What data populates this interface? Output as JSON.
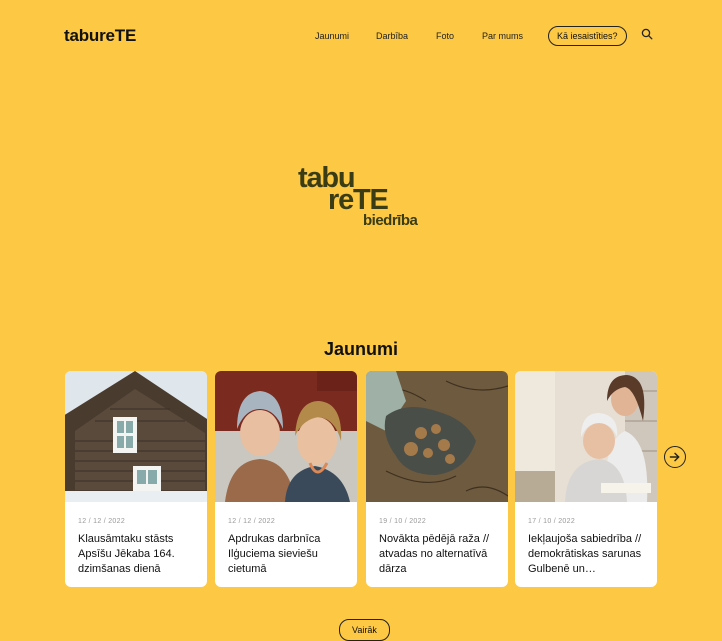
{
  "brand": "tabureTE",
  "nav": [
    "Jaunumi",
    "Darbība",
    "Foto",
    "Par mums"
  ],
  "cta": "Kā iesaistīties?",
  "logo": {
    "line1": "tabu",
    "line2": "reTE",
    "line3": "biedrība"
  },
  "section_title": "Jaunumi",
  "cards": [
    {
      "date": "12 / 12 / 2022",
      "title": "Klausāmtaku stāsts Apsīšu Jēkaba 164. dzimšanas dienā"
    },
    {
      "date": "12 / 12 / 2022",
      "title": "Apdrukas darbnīca Ilģuciema sieviešu cietumā"
    },
    {
      "date": "19 / 10 / 2022",
      "title": "Novākta pēdējā raža // atvadas no alternatīvā dārza"
    },
    {
      "date": "17 / 10 / 2022",
      "title": "Iekļaujoša sabiedrība // demokrātiskas sarunas Gulbenē un…"
    }
  ],
  "more": "Vairāk",
  "icons": {
    "search": "search-icon",
    "next": "arrow-right-icon"
  },
  "colors": {
    "background": "#fdc843",
    "text": "#111111",
    "logo": "#3a3c15"
  }
}
